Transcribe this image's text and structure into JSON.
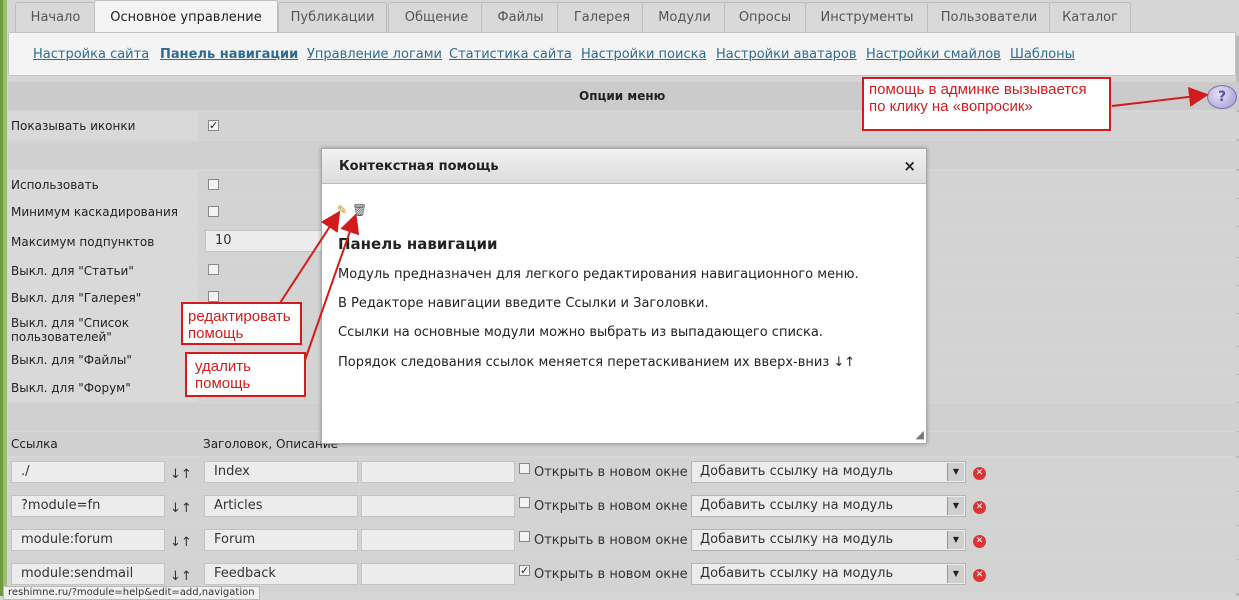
{
  "tabs": [
    "Начало",
    "Основное управление",
    "Публикации",
    "Общение",
    "Файлы",
    "Галерея",
    "Модули",
    "Опросы",
    "Инструменты",
    "Пользователи",
    "Каталог"
  ],
  "active_tab": "Основное управление",
  "subnav": [
    "Настройка сайта",
    "Панель навигации",
    "Управление логами",
    "Статистика сайта",
    "Настройки поиска",
    "Настройки аватаров",
    "Настройки смайлов",
    "Шаблоны"
  ],
  "options_header": "Опции меню",
  "settings": {
    "show_icons": "Показывать иконки",
    "use": "Использовать",
    "min_cascade": "Минимум каскадирования",
    "max_subitems": "Максимум подпунктов",
    "max_subitems_value": "10",
    "off_articles": "Выкл. для \"Статьи\"",
    "off_gallery": "Выкл. для \"Галерея\"",
    "off_userlist": "Выкл. для \"Список пользователей\"",
    "off_files": "Выкл. для \"Файлы\"",
    "off_forum": "Выкл. для \"Форум\""
  },
  "links_header": {
    "link": "Ссылка",
    "title_desc": "Заголовок, Описание"
  },
  "links": [
    {
      "url": "./",
      "title": "Index",
      "new_window": false
    },
    {
      "url": "?module=fn",
      "title": "Articles",
      "new_window": false
    },
    {
      "url": "module:forum",
      "title": "Forum",
      "new_window": false
    },
    {
      "url": "module:sendmail",
      "title": "Feedback",
      "new_window": true
    }
  ],
  "link_labels": {
    "open_new_window": "Открыть в новом окне",
    "add_module_link": "Добавить ссылку на модуль",
    "sort_glyph": "↓↑"
  },
  "modal": {
    "title": "Контекстная помощь",
    "close": "×",
    "heading": "Панель навигации",
    "paragraphs": [
      "Модуль предназначен для легкого редактирования навигационного меню.",
      "В Редакторе навигации введите Ссылки и Заголовки.",
      "Ссылки на основные модули можно выбрать из выпадающего списка.",
      "Порядок следования ссылок меняется перетаскиванием их вверх-вниз ↓↑"
    ]
  },
  "annotations": {
    "help": "помощь в админке вызывается по клику на «вопросик»",
    "edit": "редактировать помощь",
    "delete": "удалить помощь"
  },
  "status_url": "reshimne.ru/?module=help&edit=add,navigation",
  "colors": {
    "link": "#2e6c93",
    "annotation": "#d21c1c",
    "background": "#d6d6d6"
  }
}
